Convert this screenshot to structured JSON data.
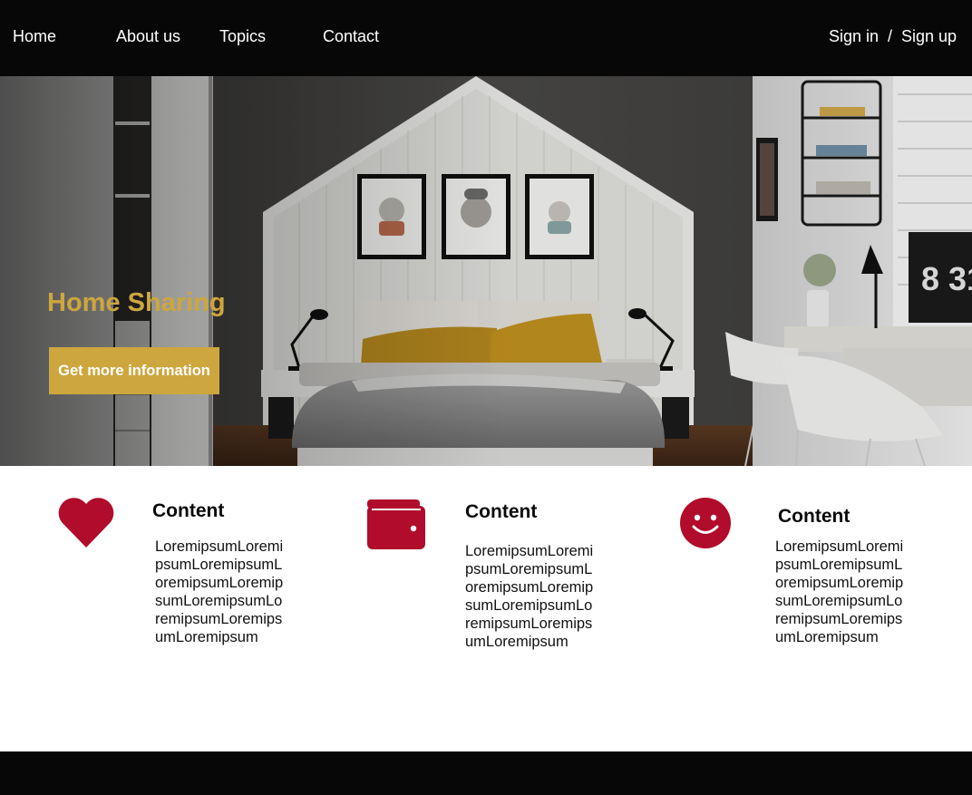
{
  "nav": {
    "home": "Home",
    "about": "About us",
    "topics": "Topics",
    "contact": "Contact",
    "sign_in": "Sign in",
    "separator": "/",
    "sign_up": "Sign up"
  },
  "hero": {
    "title": "Home Sharing",
    "button_label": "Get more information",
    "clock_text": "8 31",
    "image_subject": "bedroom-photo"
  },
  "features": [
    {
      "icon": "heart-icon",
      "title": "Content",
      "text": "LoremipsumLoremipsumLoremipsumLoremipsumLoremipsumLoremipsumLoremipsumLoremipsumLoremipsum"
    },
    {
      "icon": "wallet-icon",
      "title": "Content",
      "text": "LoremipsumLoremipsumLoremipsumLoremipsumLoremipsumLoremipsumLoremipsumLoremipsumLoremipsum"
    },
    {
      "icon": "smiley-icon",
      "title": "Content",
      "text": "LoremipsumLoremipsumLoremipsumLoremipsumLoremipsumLoremipsumLoremipsumLoremipsumLoremipsum"
    }
  ],
  "colors": {
    "nav_bg": "#070707",
    "accent_gold": "#cda63e",
    "icon_red": "#b10c2b",
    "footer_bg": "#070707"
  }
}
